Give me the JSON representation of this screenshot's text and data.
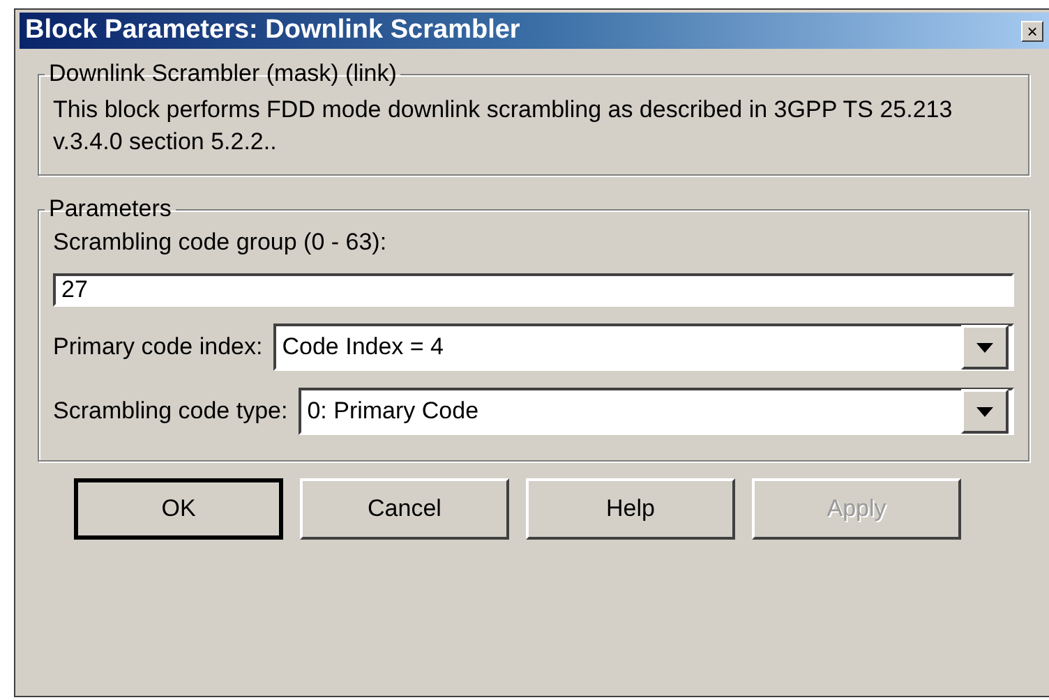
{
  "window": {
    "title": "Block Parameters: Downlink Scrambler",
    "close": "×"
  },
  "description": {
    "legend": "Downlink Scrambler (mask) (link)",
    "text": "This block performs FDD mode downlink scrambling as described in 3GPP TS 25.213 v.3.4.0 section 5.2.2.."
  },
  "parameters": {
    "legend": "Parameters",
    "fields": [
      {
        "kind": "text",
        "label": "Scrambling code group (0 - 63):",
        "value": "27"
      },
      {
        "kind": "dropdown",
        "label": "Primary code index:",
        "value": "Code Index = 4"
      },
      {
        "kind": "dropdown",
        "label": "Scrambling code type:",
        "value": "0: Primary Code"
      }
    ]
  },
  "buttons": [
    {
      "label": "OK",
      "default": true,
      "disabled": false
    },
    {
      "label": "Cancel",
      "default": false,
      "disabled": false
    },
    {
      "label": "Help",
      "default": false,
      "disabled": false
    },
    {
      "label": "Apply",
      "default": false,
      "disabled": true
    }
  ]
}
